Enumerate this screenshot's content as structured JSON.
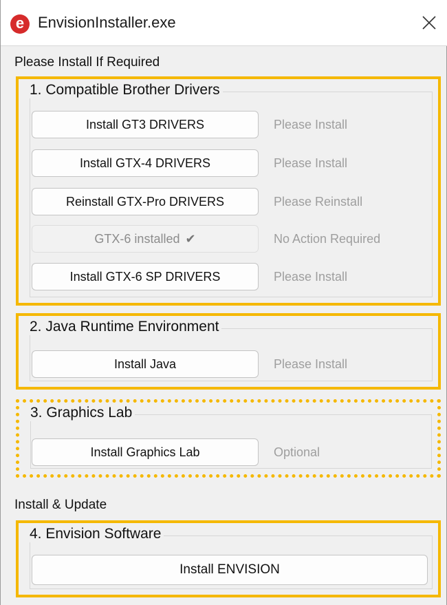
{
  "window": {
    "title": "EnvisionInstaller.exe",
    "app_icon_letter": "e"
  },
  "labels": {
    "please_install": "Please Install If Required",
    "install_update": "Install & Update"
  },
  "groups": [
    {
      "title": "1. Compatible Brother Drivers",
      "items": [
        {
          "button": "Install GT3 DRIVERS",
          "status": "Please Install"
        },
        {
          "button": "Install GTX-4 DRIVERS",
          "status": "Please Install"
        },
        {
          "button": "Reinstall GTX-Pro DRIVERS",
          "status": "Please Reinstall"
        },
        {
          "button": "GTX-6 installed",
          "status": "No Action Required",
          "disabled": true
        },
        {
          "button": "Install GTX-6 SP DRIVERS",
          "status": "Please Install"
        }
      ]
    },
    {
      "title": "2. Java Runtime Environment",
      "items": [
        {
          "button": "Install Java",
          "status": "Please Install"
        }
      ]
    },
    {
      "title": "3. Graphics Lab",
      "items": [
        {
          "button": "Install Graphics Lab",
          "status": "Optional"
        }
      ]
    },
    {
      "title": "4. Envision Software",
      "items": [
        {
          "button": "Install ENVISION"
        }
      ]
    }
  ],
  "colors": {
    "highlight": "#f5b800",
    "status_text": "#9e9e9e",
    "app_icon": "#d62b2b"
  }
}
